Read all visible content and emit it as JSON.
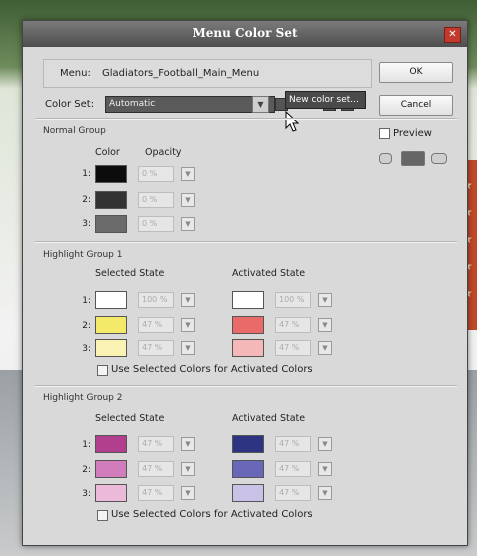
{
  "dialog": {
    "title": "Menu Color Set",
    "menu_label": "Menu:",
    "menu_value": "Gladiators_Football_Main_Menu",
    "ok_label": "OK",
    "cancel_label": "Cancel",
    "color_set_label": "Color Set:",
    "color_set_value": "Automatic",
    "tooltip": "New color set...",
    "preview_label": "Preview"
  },
  "normal_group": {
    "label": "Normal Group",
    "color_header": "Color",
    "opacity_header": "Opacity",
    "rows": [
      {
        "num": "1:",
        "color": "#0c0c0c",
        "opacity": "0 %"
      },
      {
        "num": "2:",
        "color": "#333333",
        "opacity": "0 %"
      },
      {
        "num": "3:",
        "color": "#6b6b6b",
        "opacity": "0 %"
      }
    ]
  },
  "highlight_group_1": {
    "label": "Highlight Group 1",
    "selected_header": "Selected State",
    "activated_header": "Activated State",
    "rows": [
      {
        "num": "1:",
        "sel_color": "#ffffff",
        "sel_opacity": "100 %",
        "act_color": "#ffffff",
        "act_opacity": "100 %"
      },
      {
        "num": "2:",
        "sel_color": "#f4ea6a",
        "sel_opacity": "47 %",
        "act_color": "#ea6a6a",
        "act_opacity": "47 %"
      },
      {
        "num": "3:",
        "sel_color": "#fbf3b4",
        "sel_opacity": "47 %",
        "act_color": "#f4b8b8",
        "act_opacity": "47 %"
      }
    ],
    "checkbox_label": "Use Selected Colors for Activated Colors"
  },
  "highlight_group_2": {
    "label": "Highlight Group 2",
    "selected_header": "Selected State",
    "activated_header": "Activated State",
    "rows": [
      {
        "num": "1:",
        "sel_color": "#b13f8e",
        "sel_opacity": "47 %",
        "act_color": "#2d3583",
        "act_opacity": "47 %"
      },
      {
        "num": "2:",
        "sel_color": "#d17dbb",
        "sel_opacity": "47 %",
        "act_color": "#6a67b8",
        "act_opacity": "47 %"
      },
      {
        "num": "3:",
        "sel_color": "#ebbad9",
        "sel_opacity": "47 %",
        "act_color": "#c9c2e6",
        "act_opacity": "47 %"
      }
    ],
    "checkbox_label": "Use Selected Colors for Activated Colors"
  }
}
